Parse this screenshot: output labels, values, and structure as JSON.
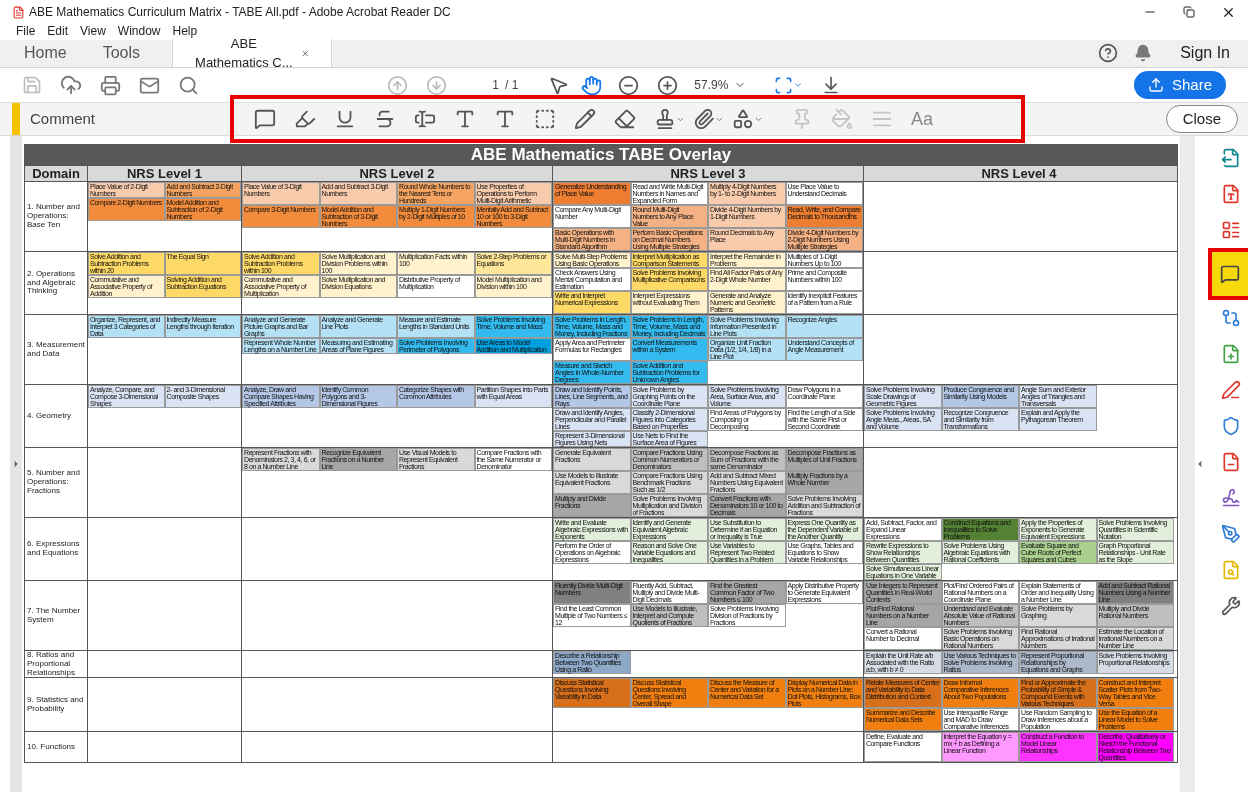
{
  "window": {
    "title": "ABE Mathematics Curriculum Matrix - TABE All.pdf - Adobe Acrobat Reader DC"
  },
  "menu": [
    "File",
    "Edit",
    "View",
    "Window",
    "Help"
  ],
  "nav_tabs": [
    {
      "label": "Home",
      "selected": false
    },
    {
      "label": "Tools",
      "selected": false
    },
    {
      "label": "ABE Mathematics C...",
      "selected": true
    }
  ],
  "account": {
    "sign_in": "Sign In"
  },
  "toolbar": {
    "page": "1",
    "page_total": "/ 1",
    "zoom": "57.9%",
    "share": "Share",
    "tools": [
      {
        "selected": false
      },
      {
        "selected": true
      }
    ]
  },
  "comment_bar": {
    "title": "Comment",
    "font_label": "Aa",
    "close": "Close",
    "tools": [
      {
        "menu": false,
        "disabled": false
      },
      {
        "menu": false,
        "disabled": false
      },
      {
        "menu": false,
        "disabled": false
      },
      {
        "menu": false,
        "disabled": false
      },
      {
        "menu": false,
        "disabled": false
      },
      {
        "menu": false,
        "disabled": false
      },
      {
        "menu": false,
        "disabled": false
      },
      {
        "menu": false,
        "disabled": false
      },
      {
        "menu": false,
        "disabled": false
      },
      {
        "menu": false,
        "disabled": false
      },
      {
        "menu": true,
        "disabled": false
      },
      {
        "menu": true,
        "disabled": false
      },
      {
        "menu": true,
        "disabled": false
      },
      {
        "menu": false,
        "disabled": true
      },
      {
        "menu": false,
        "disabled": true
      },
      {
        "menu": false,
        "disabled": true
      }
    ]
  },
  "sidebar": [
    {
      "selected": false
    },
    {
      "selected": false
    },
    {
      "selected": false
    },
    {
      "selected": true
    },
    {
      "selected": false
    },
    {
      "selected": false
    },
    {
      "selected": false
    },
    {
      "selected": false
    },
    {
      "selected": false
    },
    {
      "selected": false
    },
    {
      "selected": false
    },
    {
      "selected": false
    },
    {
      "selected": false
    }
  ],
  "document": {
    "title": "ABE Mathematics TABE Overlay",
    "columns": [
      "Domain",
      "NRS Level 1",
      "NRS Level 2",
      "NRS Level 3",
      "NRS Level 4"
    ],
    "rows": [
      {
        "domain": "1. Number and Operations: Base Ten",
        "nrs_1": [
          [
            {
              "text": "Place Value of 2-Digit Numbers",
              "color": "#f8cbad"
            },
            {
              "text": "Add and Subtract 2-Digit Numbers",
              "color": "#f4a460"
            }
          ],
          [
            {
              "text": "Compare 2-Digit Numbers",
              "color": "#f28c3c"
            },
            {
              "text": "Model Addition and Subtraction of 2-Digit Numbers",
              "color": "#f28c3c"
            }
          ]
        ],
        "nrs_2": [
          [
            {
              "text": "Place Value of 3-Digit Numbers",
              "color": "#f8cbad"
            },
            {
              "text": "Add and Subtract 3-Digit Numbers",
              "color": "#f8cbad"
            },
            {
              "text": "Round Whole Numbers to the Nearest Tens or Hundreds",
              "color": "#f4a460"
            },
            {
              "text": "Use Properties of Operations to Perform Multi-Digit Arithmetic",
              "color": "#f8cbad"
            }
          ],
          [
            {
              "text": "Compare 3-Digit Numbers",
              "color": "#f28c3c"
            },
            {
              "text": "Model Addition and Subtraction of 3-Digit Numbers",
              "color": "#f28c3c"
            },
            {
              "text": "Multiply 1-Digit Numbers by 2-Digit Multiples of 10",
              "color": "#f28c3c"
            },
            {
              "text": "Mentally Add and Subtract 10 or 100 to 3-Digit Numbers",
              "color": "#f28c3c"
            }
          ]
        ],
        "nrs_3": [
          [
            {
              "text": "Generalize Understanding of Place Value",
              "color": "#ed7d31"
            },
            {
              "text": "Read and Write Multi-Digit Numbers in Names and Expanded Form",
              "color": "#ffffff"
            },
            {
              "text": "Multiply 4-Digit Numbers by 1- to 2-Digit Numbers",
              "color": "#f8cbad"
            },
            {
              "text": "Use Place Value to Understand Decimals",
              "color": "#ffffff"
            }
          ],
          [
            {
              "text": "Compare Any Multi-Digit Number",
              "color": "#ffffff"
            },
            {
              "text": "Round Multi-Digit Numbers to Any Place Value",
              "color": "#f4b183"
            },
            {
              "text": "Divide 4-Digit Numbers by 1-Digit Numbers",
              "color": "#f8cbad"
            },
            {
              "text": "Read, Write, and Compare Decimals to Thousandths",
              "color": "#ed7d31"
            }
          ],
          [
            {
              "text": "Basic Operations with Multi-Digit Numbers in Standard Algorithm",
              "color": "#f4b183"
            },
            {
              "text": "Perform Basic Operations on Decimal Numbers Using Multiple Strategies",
              "color": "#f4b183"
            },
            {
              "text": "Round Decimals to Any Place",
              "color": "#f8cbad"
            },
            {
              "text": "Divide 4-Digit Numbers by 2-Digit Numbers Using Multiple Strategies",
              "color": "#f4b183"
            }
          ]
        ]
      },
      {
        "domain": "2. Operations and Algebraic Thinking",
        "nrs_1": [
          [
            {
              "text": "Solve Addition and Subtraction Problems within 20",
              "color": "#ffd966"
            },
            {
              "text": "The Equal Sign",
              "color": "#ffd966"
            }
          ],
          [
            {
              "text": "Commutative and Associative Property of Addition",
              "color": "#fff2cc"
            },
            {
              "text": "Solving Addition and Subtraction Equations",
              "color": "#ffd966"
            }
          ]
        ],
        "nrs_2": [
          [
            {
              "text": "Solve Addition and Subtraction Problems within 100",
              "color": "#ffd966"
            },
            {
              "text": "Solve Multiplication and Division Problems within 100",
              "color": "#fff2cc"
            },
            {
              "text": "Multiplication Facts within 100",
              "color": "#fff2cc"
            },
            {
              "text": "Solve 2-Step Problems or Equations",
              "color": "#ffe699"
            }
          ],
          [
            {
              "text": "Commutative and Associative Property of Multiplication",
              "color": "#fff2cc"
            },
            {
              "text": "Solve Multiplication and Division Equations",
              "color": "#fff2cc"
            },
            {
              "text": "Distributive Property of Multiplication",
              "color": "#ffffff"
            },
            {
              "text": "Model Multiplication and Division within 100",
              "color": "#fff2cc"
            }
          ]
        ],
        "nrs_3": [
          [
            {
              "text": "Solve Multi-Step Problems Using Basic Operations",
              "color": "#fff2cc"
            },
            {
              "text": "Interpret Multiplication as Comparison Statements",
              "color": "#ffd966"
            },
            {
              "text": "Interpret the Remainder in Problems",
              "color": "#fff2cc"
            },
            {
              "text": "Multiples of 1-Digit Numbers Up to 100",
              "color": "#ffffff"
            }
          ],
          [
            {
              "text": "Check Answers Using Mental Computation and Estimation",
              "color": "#ffffff"
            },
            {
              "text": "Solve Problems Involving Multiplicative Comparisons",
              "color": "#ffd966"
            },
            {
              "text": "Find All Factor Pairs of Any 2-Digit Whole Number",
              "color": "#fff2cc"
            },
            {
              "text": "Prime and Composite Numbers within 100",
              "color": "#ffffff"
            }
          ],
          [
            {
              "text": "Write and Interpret Numerical Expressions",
              "color": "#ffd966"
            },
            {
              "text": "Interpret Expressions without Evaluating Them",
              "color": "#fff2cc"
            },
            {
              "text": "Generate and Analyze Numeric and Geometric Patterns",
              "color": "#fff2cc"
            },
            {
              "text": "Identify Inexplicit Features of a Pattern from a Rule",
              "color": "#ffffff"
            }
          ]
        ]
      },
      {
        "domain": "3. Measurement and Data",
        "nrs_1": [
          [
            {
              "text": "Organize, Represent, and Interpret 3 Categories of Data",
              "color": "#b4e1f5"
            },
            {
              "text": "Indirectly Measure Lengths through Iteration",
              "color": "#b4e1f5"
            }
          ]
        ],
        "nrs_2": [
          [
            {
              "text": "Analyze and Generate Picture Graphs and Bar Graphs",
              "color": "#b4e1f5"
            },
            {
              "text": "Analyze and Generate Line Plots",
              "color": "#b4e1f5"
            },
            {
              "text": "Measure and Estimate Lengths in Standard Units",
              "color": "#b4e1f5"
            },
            {
              "text": "Solve Problems Involving Time, Volume and Mass",
              "color": "#33bbf0"
            }
          ],
          [
            {
              "text": "Represent Whole Number Lengths on a Number Line",
              "color": "#b4e1f5"
            },
            {
              "text": "Measuring and Estimating Areas of Plane Figures",
              "color": "#b4e1f5"
            },
            {
              "text": "Solve Problems Involving Perimeter of Polygons",
              "color": "#33bbf0"
            },
            {
              "text": "Use Areas to Model Addition and Multiplication",
              "color": "#00a0e0"
            }
          ]
        ],
        "nrs_3": [
          [
            {
              "text": "Solve Problems in Length, Time, Volume, Mass and Money, Including Fractions",
              "color": "#33bbf0"
            },
            {
              "text": "Solve Problems in Length, Time, Volume, Mass and Money, Including Decimals",
              "color": "#33bbf0"
            },
            {
              "text": "Solve Problems Involving Information Presented in Line Plots",
              "color": "#b4e1f5"
            },
            {
              "text": "Recognize Angles",
              "color": "#b4e1f5"
            }
          ],
          [
            {
              "text": "Apply Area and Perimeter Formulas for Rectangles",
              "color": "#ffffff"
            },
            {
              "text": "Convert Measurements within a System",
              "color": "#33bbf0"
            },
            {
              "text": "Organize Unit Fraction Data (1/2, 1/4, 1/8) in a Line Plot",
              "color": "#b4e1f5"
            },
            {
              "text": "Understand Concepts of Angle Measurement",
              "color": "#b4e1f5"
            }
          ],
          [
            {
              "text": "Measure and Sketch Angles in Whole-Number Degrees",
              "color": "#33bbf0"
            },
            {
              "text": "Solve Addition and Subtraction Problems for Unknown Angles",
              "color": "#33bbf0"
            }
          ]
        ]
      },
      {
        "domain": "4. Geometry",
        "nrs_1": [
          [
            {
              "text": "Analyze, Compare, and Compose 3-Dimensional Shapes",
              "color": "#dae3f3"
            },
            {
              "text": "2- and 3-Dimensional Composite Shapes",
              "color": "#dae3f3"
            }
          ]
        ],
        "nrs_2": [
          [
            {
              "text": "Analyze, Draw and Compare Shapes Having Specified Attributes",
              "color": "#b4c7e7"
            },
            {
              "text": "Identify Common Polygons and 3-Dimensional Figures",
              "color": "#b4c7e7"
            },
            {
              "text": "Categorize Shapes with Common Attributes",
              "color": "#b4c7e7"
            },
            {
              "text": "Partition Shapes into Parts with Equal Areas",
              "color": "#dae3f3"
            }
          ]
        ],
        "nrs_3": [
          [
            {
              "text": "Draw and Identify Points, Lines, Line Segments, and Rays",
              "color": "#b4c7e7"
            },
            {
              "text": "Solve Problems by Graphing Points on the Coordinate Plane",
              "color": "#dae3f3"
            },
            {
              "text": "Solve Problems Involving Area, Surface Area, and Volume",
              "color": "#dae3f3"
            },
            {
              "text": "Draw Polygons in a Coordinate Plane",
              "color": "#ffffff"
            }
          ],
          [
            {
              "text": "Draw and Identify Angles, Perpendicular and Parallel Lines",
              "color": "#dae3f3"
            },
            {
              "text": "Classify 2-Dimensional Figures into Categories Based on Properties",
              "color": "#dae3f3"
            },
            {
              "text": "Find Areas of Polygons by Composing or Decomposing",
              "color": "#ffffff"
            },
            {
              "text": "Find the Length of a Side with the Same First or Second Coordinate",
              "color": "#ffffff"
            }
          ],
          [
            {
              "text": "Represent 3-Dimensional Figures Using Nets",
              "color": "#dae3f3"
            },
            {
              "text": "Use Nets to Find the Surface Area of Figures",
              "color": "#dae3f3"
            }
          ]
        ],
        "nrs_4": [
          [
            {
              "text": "Solve Problems Involving Scale Drawings of Geometric Figures",
              "color": "#dae3f3"
            },
            {
              "text": "Produce Congruence and Similarity Using Models",
              "color": "#b4c7e7"
            },
            {
              "text": "Angle Sum and Exterior Angles of Triangles and Transversals",
              "color": "#dae3f3"
            }
          ],
          [
            {
              "text": "Solve Problems Involving Angle Meas., Areas, SA and Volume",
              "color": "#dae3f3"
            },
            {
              "text": "Recognize Congruence and Similarity from Transformations",
              "color": "#dae3f3"
            },
            {
              "text": "Explain and Apply the Pythagorean Theorem",
              "color": "#dae3f3"
            }
          ]
        ]
      },
      {
        "domain": "5. Number and Operations: Fractions",
        "nrs_2": [
          [
            {
              "text": "Represent Fractions with Denominators 2, 3, 4, 6, or 8 on a Number Line",
              "color": "#d9d9d9"
            },
            {
              "text": "Recognize Equivalent Fractions on a Number Line",
              "color": "#a6a6a6"
            },
            {
              "text": "Use Visual Models to Represent Equivalent Fractions",
              "color": "#d9d9d9"
            },
            {
              "text": "Compare Fractions with the Same Numerator or Denominator",
              "color": "#ffffff"
            }
          ]
        ],
        "nrs_3": [
          [
            {
              "text": "Generate Equivalent Fractions",
              "color": "#d9d9d9"
            },
            {
              "text": "Compare Fractions Using Common Numerators or Denominators",
              "color": "#bfbfbf"
            },
            {
              "text": "Decompose Fractions as Sum of Fractions with the same Denominator",
              "color": "#bfbfbf"
            },
            {
              "text": "Decompose Fractions as Multiples of Unit Fractions",
              "color": "#a6a6a6"
            }
          ],
          [
            {
              "text": "Use Models to Illustrate Equivalent Fractions",
              "color": "#d9d9d9"
            },
            {
              "text": "Compare Fractions Using Benchmark Fractions Such as 1/2",
              "color": "#d9d9d9"
            },
            {
              "text": "Add and Subtract Mixed Numbers Using Equivalent Fractions",
              "color": "#d9d9d9"
            },
            {
              "text": "Multiply Fractions by a Whole Number",
              "color": "#a6a6a6"
            }
          ],
          [
            {
              "text": "Multiply and Divide Fractions",
              "color": "#a6a6a6"
            },
            {
              "text": "Solve Problems Involving Multiplication and Division of Fractions",
              "color": "#d9d9d9"
            },
            {
              "text": "Convert Fractions with Denominators 10 or 100 to Decimals",
              "color": "#a6a6a6"
            },
            {
              "text": "Solve Problems Involving Addition and Subtraction of Fractions",
              "color": "#d9d9d9"
            }
          ]
        ]
      },
      {
        "domain": "6. Expressions and Equations",
        "nrs_3": [
          [
            {
              "text": "Write and Evaluate Algebraic Expressions with Exponents",
              "color": "#e2efda"
            },
            {
              "text": "Identify and Generate Equivalent Algebraic Expressions",
              "color": "#e2efda"
            },
            {
              "text": "Use Substitution to Determine if an Equation or Inequality is True",
              "color": "#e2efda"
            },
            {
              "text": "Express One Quantity as the Dependent Variable of the Another Quantity",
              "color": "#e2efda"
            }
          ],
          [
            {
              "text": "Perform the Order of Operations on Algebraic Expressions",
              "color": "#ffffff"
            },
            {
              "text": "Reason and Solve One Variable Equations and Inequalities",
              "color": "#e2efda"
            },
            {
              "text": "Use Variables to Represent Two Related Quantities in a Problem",
              "color": "#e2efda"
            },
            {
              "text": "Use Graphs, Tables and Equations to Show Variable Relationships",
              "color": "#ffffff"
            }
          ]
        ],
        "nrs_4": [
          [
            {
              "text": "Add, Subtract, Factor, and Expand Linear Expressions",
              "color": "#ffffff"
            },
            {
              "text": "Construct Equations and Inequalities to Solve Problems",
              "color": "#548235"
            },
            {
              "text": "Apply the Properties of Exponents to Generate Equivalent Expressions",
              "color": "#e2efda"
            },
            {
              "text": "Solve Problems Involving Quantities in Scientific Notation",
              "color": "#e2efda"
            }
          ],
          [
            {
              "text": "Rewrite Expressions to Show Relationships Between Quantities",
              "color": "#e2efda"
            },
            {
              "text": "Solve Problems Using Algebraic Equations with Rational Coefficients",
              "color": "#e2efda"
            },
            {
              "text": "Evaluate Square and Cube Roots of Perfect Squares and Cubes",
              "color": "#a9d08e"
            },
            {
              "text": "Graph Proportional Relationships - Unit Rate as the Slope",
              "color": "#e2efda"
            }
          ],
          [
            {
              "text": "Solve Simultaneous Linear Equations in One Variable",
              "color": "#e2efda"
            }
          ]
        ]
      },
      {
        "domain": "7. The Number System",
        "nrs_3": [
          [
            {
              "text": "Fluently Divide Multi-Digit Numbers",
              "color": "#808080"
            },
            {
              "text": "Fluently Add, Subtract, Multiply and Divide Multi-Digit Decimals",
              "color": "#ffffff"
            },
            {
              "text": "Find the Greatest Common Factor of Two Numbers ≤ 100",
              "color": "#a6a6a6"
            },
            {
              "text": "Apply Distributive Property to Generate Equivalent Expressions",
              "color": "#ffffff"
            }
          ],
          [
            {
              "text": "Find the Least Common Multiple of Two Numbers ≤ 12",
              "color": "#ffffff"
            },
            {
              "text": "Use Models to Illustrate, Interpret and Compute Quotients of Fractions",
              "color": "#bfbfbf"
            },
            {
              "text": "Solve Problems Involving Division of Fractions by Fractions",
              "color": "#ffffff"
            }
          ]
        ],
        "nrs_4": [
          [
            {
              "text": "Use Integers to Represent Quantities in Real-World Contexts",
              "color": "#a6a6a6"
            },
            {
              "text": "Plot/Find Ordered Pairs of Rational Numbers on a Coordinate Plane",
              "color": "#ffffff"
            },
            {
              "text": "Explain Statements of Order and Inequality Using a Number Line",
              "color": "#ffffff"
            },
            {
              "text": "Add and Subtract Rational Numbers Using a Number Line",
              "color": "#808080"
            }
          ],
          [
            {
              "text": "Plot/Find Rational Numbers on a Number Line",
              "color": "#a6a6a6"
            },
            {
              "text": "Understand and Evaluate Absolute Value of Rational Numbers",
              "color": "#bfbfbf"
            },
            {
              "text": "Solve Problems by Graphing",
              "color": "#d9d9d9"
            },
            {
              "text": "Multiply and Divide Rational Numbers",
              "color": "#bfbfbf"
            }
          ],
          [
            {
              "text": "Convert a Rational Number to Decimal",
              "color": "#ffffff"
            },
            {
              "text": "Solve Problems Involving Basic Operations on Rational Numbers",
              "color": "#d9d9d9"
            },
            {
              "text": "Find Rational Approximations of Irrational Numbers",
              "color": "#d9d9d9"
            },
            {
              "text": "Estimate the Location of Irrational Numbers on a Number Line",
              "color": "#d9d9d9"
            }
          ]
        ]
      },
      {
        "domain": "8. Ratios and Proportional Relationships",
        "nrs_3": [
          [
            {
              "text": "Describe a Relationship Between Two Quantities Using a Ratio",
              "color": "#8ea9c8"
            }
          ]
        ],
        "nrs_4": [
          [
            {
              "text": "Explain the Unit Rate a/b Associated with the Ratio a:b, with b ≠ 0",
              "color": "#d6dce4"
            },
            {
              "text": "Use Various Techniques to Solve Problems Involving Ratios",
              "color": "#acb9ca"
            },
            {
              "text": "Represent Proportional Relationships by Equations and Graphs",
              "color": "#acb9ca"
            },
            {
              "text": "Solve Problems Involving Proportional Relationships",
              "color": "#d6dce4"
            }
          ]
        ]
      },
      {
        "domain": "9. Statistics and Probability",
        "nrs_3": [
          [
            {
              "text": "Discuss Statistical Questions Involving Variability in Data",
              "color": "#d86f1a"
            },
            {
              "text": "Discuss Statistical Questions Involving Center, Spread and Overall Shape",
              "color": "#f07f0f"
            },
            {
              "text": "Discuss the Measure of Center and Variation for a Numerical Data Set",
              "color": "#f07f0f"
            },
            {
              "text": "Display Numerical Data in Plots on a Number Line: Dot Plots, Histograms, Box Plots",
              "color": "#f07f0f"
            }
          ]
        ],
        "nrs_4": [
          [
            {
              "text": "Relate Measures of Center and Variability to Data Distribution and Context",
              "color": "#d86f1a"
            },
            {
              "text": "Draw Informal Comparative Inferences About Two Populations",
              "color": "#f07f0f"
            },
            {
              "text": "Find or Approximate the Probability of Simple & Compound Events with Various Techniques",
              "color": "#d86f1a"
            },
            {
              "text": "Construct and Interpret Scatter Plots from Two-Way Tables and Vice Versa",
              "color": "#f07f0f"
            }
          ],
          [
            {
              "text": "Summarize and Describe Numerical Data Sets",
              "color": "#f07f0f"
            },
            {
              "text": "Use Interquartile Range and MAD to Draw Comparative Inferences",
              "color": "#ffffff"
            },
            {
              "text": "Use Random Sampling to Draw Inferences about a Population",
              "color": "#ffffff"
            },
            {
              "text": "Use the Equation of a Linear Model to Solve Problems",
              "color": "#f07f0f"
            }
          ]
        ]
      },
      {
        "domain": "10. Functions",
        "nrs_4": [
          [
            {
              "text": "Define, Evaluate and Compare Functions",
              "color": "#ffffff"
            },
            {
              "text": "Interpret the Equation y = mx + b as Defining a Linear Function",
              "color": "#ff99ff"
            },
            {
              "text": "Construct a Function to Model Linear Relationships",
              "color": "#ff33ff"
            },
            {
              "text": "Describe, Qualitatively or Sketch the Functional Relationship Between Two Quantities",
              "color": "#ff00ff"
            }
          ]
        ]
      }
    ]
  }
}
